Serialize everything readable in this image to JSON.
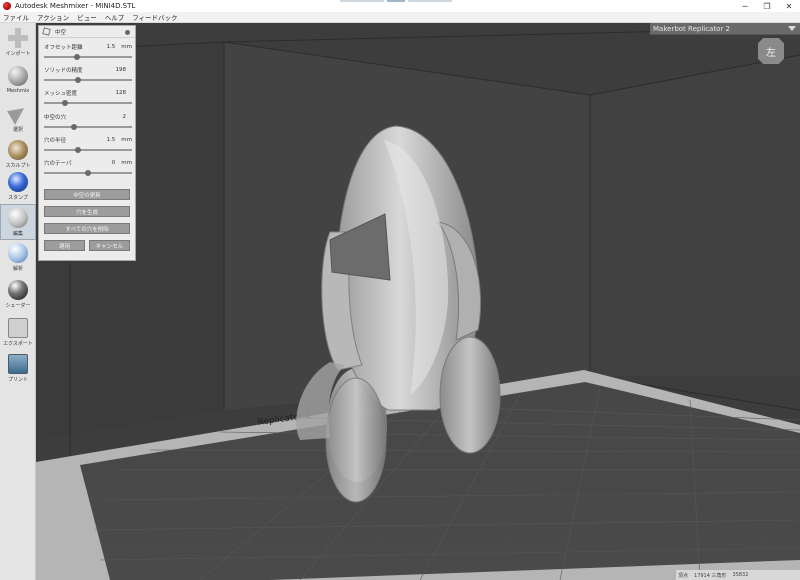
{
  "window": {
    "title": "Autodesk Meshmixer - MINI4D.STL",
    "minimize": "─",
    "restore": "❐",
    "close": "✕"
  },
  "menu": [
    "ファイル",
    "アクション",
    "ビュー",
    "ヘルプ",
    "フィードバック"
  ],
  "toolbar": [
    {
      "label": "インポート",
      "icon": "plus-icon"
    },
    {
      "label": "Meshmix",
      "icon": "meshmix-icon"
    },
    {
      "label": "選択",
      "icon": "select-arrow-icon"
    },
    {
      "label": "スカルプト",
      "icon": "sculpt-brush-icon"
    },
    {
      "label": "スタンプ",
      "icon": "stamp-icon"
    },
    {
      "label": "編集",
      "icon": "edit-icon"
    },
    {
      "label": "解析",
      "icon": "analysis-icon"
    },
    {
      "label": "シェーダー",
      "icon": "shader-icon"
    },
    {
      "label": "エクスポート",
      "icon": "export-icon"
    },
    {
      "label": "プリント",
      "icon": "print-icon"
    }
  ],
  "panel": {
    "title": "中空",
    "params": [
      {
        "label": "オフセット距離",
        "value": "1.5",
        "unit": "mm",
        "fraction": 0.36
      },
      {
        "label": "ソリッドの精度",
        "value": "198",
        "unit": "",
        "fraction": 0.38
      },
      {
        "label": "メッシュ密度",
        "value": "128",
        "unit": "",
        "fraction": 0.22
      },
      {
        "label": "中空の穴",
        "value": "2",
        "unit": "",
        "fraction": 0.33
      },
      {
        "label": "穴の半径",
        "value": "1.5",
        "unit": "mm",
        "fraction": 0.38
      },
      {
        "label": "穴のテーパ",
        "value": "0",
        "unit": "mm",
        "fraction": 0.5
      }
    ],
    "buttons": {
      "update": "中空の更新",
      "generate": "穴を生成",
      "remove_all": "すべての穴を削除",
      "accept": "適用",
      "cancel": "キャンセル"
    }
  },
  "printer": {
    "name": "Makerbot Replicator 2"
  },
  "viewcube": {
    "label": "左"
  },
  "bed": {
    "label": "Replicator 2"
  },
  "status": {
    "label": "頂点",
    "value1": "17914 三角形",
    "value2": "35832"
  }
}
